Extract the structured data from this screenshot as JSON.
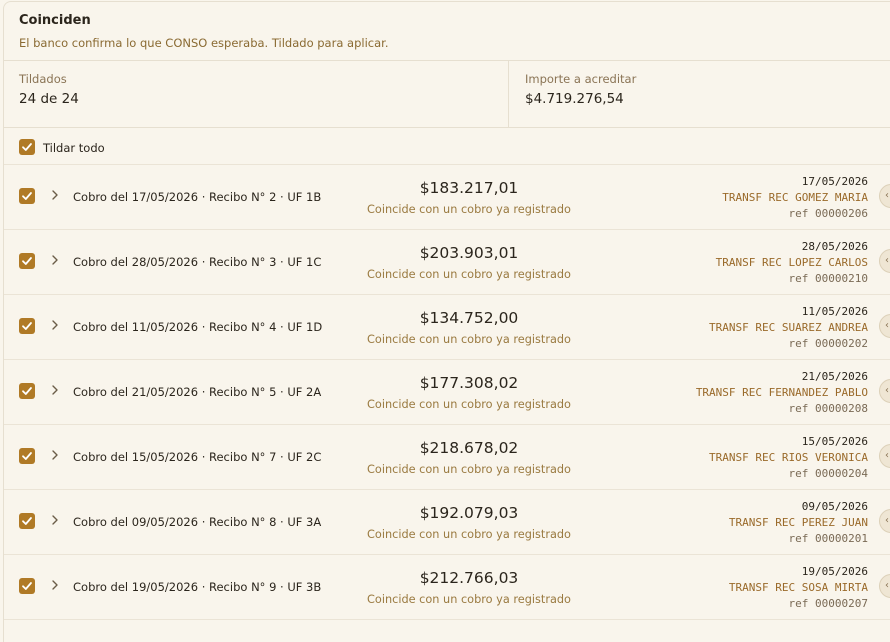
{
  "section": {
    "title": "Coinciden",
    "subtitle": "El banco confirma lo que CONSO esperaba. Tildado para aplicar."
  },
  "stats": {
    "checked_label": "Tildados",
    "checked_value": "24 de 24",
    "amount_label": "Importe a acreditar",
    "amount_value": "$4.719.276,54"
  },
  "select_all": {
    "label": "Tildar todo",
    "checked": true
  },
  "colors": {
    "accent": "#b07a26"
  },
  "rows": [
    {
      "description": "Cobro del 17/05/2026 · Recibo N° 2 · UF 1B",
      "amount": "$183.217,01",
      "status": "Coincide con un cobro ya registrado",
      "bank_date": "17/05/2026",
      "bank_name": "TRANSF REC GOMEZ MARIA",
      "bank_ref": "ref 00000206"
    },
    {
      "description": "Cobro del 28/05/2026 · Recibo N° 3 · UF 1C",
      "amount": "$203.903,01",
      "status": "Coincide con un cobro ya registrado",
      "bank_date": "28/05/2026",
      "bank_name": "TRANSF REC LOPEZ CARLOS",
      "bank_ref": "ref 00000210"
    },
    {
      "description": "Cobro del 11/05/2026 · Recibo N° 4 · UF 1D",
      "amount": "$134.752,00",
      "status": "Coincide con un cobro ya registrado",
      "bank_date": "11/05/2026",
      "bank_name": "TRANSF REC SUAREZ ANDREA",
      "bank_ref": "ref 00000202"
    },
    {
      "description": "Cobro del 21/05/2026 · Recibo N° 5 · UF 2A",
      "amount": "$177.308,02",
      "status": "Coincide con un cobro ya registrado",
      "bank_date": "21/05/2026",
      "bank_name": "TRANSF REC FERNANDEZ PABLO",
      "bank_ref": "ref 00000208"
    },
    {
      "description": "Cobro del 15/05/2026 · Recibo N° 7 · UF 2C",
      "amount": "$218.678,02",
      "status": "Coincide con un cobro ya registrado",
      "bank_date": "15/05/2026",
      "bank_name": "TRANSF REC RIOS VERONICA",
      "bank_ref": "ref 00000204"
    },
    {
      "description": "Cobro del 09/05/2026 · Recibo N° 8 · UF 3A",
      "amount": "$192.079,03",
      "status": "Coincide con un cobro ya registrado",
      "bank_date": "09/05/2026",
      "bank_name": "TRANSF REC PEREZ JUAN",
      "bank_ref": "ref 00000201"
    },
    {
      "description": "Cobro del 19/05/2026 · Recibo N° 9 · UF 3B",
      "amount": "$212.766,03",
      "status": "Coincide con un cobro ya registrado",
      "bank_date": "19/05/2026",
      "bank_name": "TRANSF REC SOSA MIRTA",
      "bank_ref": "ref 00000207"
    }
  ]
}
